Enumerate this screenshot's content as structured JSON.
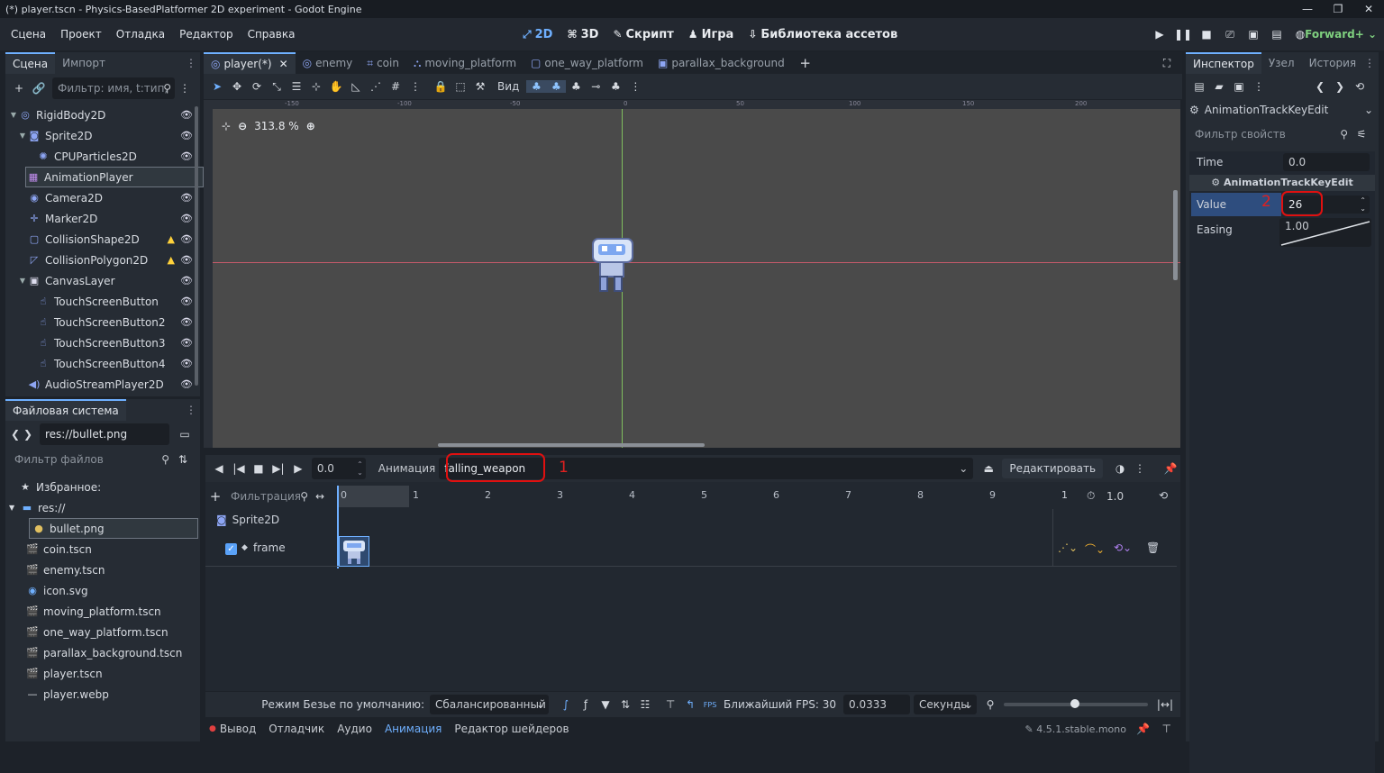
{
  "window": {
    "title": "(*) player.tscn - Physics-BasedPlatformer 2D experiment - Godot Engine"
  },
  "menu": [
    "Сцена",
    "Проект",
    "Отладка",
    "Редактор",
    "Справка"
  ],
  "workspaces": [
    {
      "icon": "⤢",
      "label": "2D"
    },
    {
      "icon": "⌘",
      "label": "3D"
    },
    {
      "icon": "✎",
      "label": "Скрипт"
    },
    {
      "icon": "♟",
      "label": "Игра"
    },
    {
      "icon": "⇩",
      "label": "Библиотека ассетов"
    }
  ],
  "renderer": "Forward+",
  "scene_dock": {
    "tabs": [
      "Сцена",
      "Импорт"
    ],
    "filter_placeholder": "Фильтр: имя, t:тип,",
    "nodes": [
      {
        "label": "RigidBody2D",
        "depth": 0,
        "arrow": "v",
        "icon": "◎",
        "color": "#8da5f3",
        "eye": true
      },
      {
        "label": "Sprite2D",
        "depth": 1,
        "arrow": "v",
        "icon": "◙",
        "color": "#8da5f3",
        "eye": true
      },
      {
        "label": "CPUParticles2D",
        "depth": 2,
        "arrow": "",
        "icon": "✺",
        "color": "#8da5f3",
        "eye": true
      },
      {
        "label": "AnimationPlayer",
        "depth": 1,
        "arrow": "",
        "icon": "▦",
        "color": "#c38ef1",
        "eye": false,
        "selected": true
      },
      {
        "label": "Camera2D",
        "depth": 1,
        "arrow": "",
        "icon": "◉",
        "color": "#8da5f3",
        "eye": true
      },
      {
        "label": "Marker2D",
        "depth": 1,
        "arrow": "",
        "icon": "✛",
        "color": "#8da5f3",
        "eye": true
      },
      {
        "label": "CollisionShape2D",
        "depth": 1,
        "arrow": "",
        "icon": "▢",
        "color": "#8da5f3",
        "eye": true,
        "warn": true
      },
      {
        "label": "CollisionPolygon2D",
        "depth": 1,
        "arrow": "",
        "icon": "◸",
        "color": "#8da5f3",
        "eye": true,
        "warn": true
      },
      {
        "label": "CanvasLayer",
        "depth": 1,
        "arrow": "v",
        "icon": "▣",
        "color": "#dde",
        "eye": true
      },
      {
        "label": "TouchScreenButton",
        "depth": 2,
        "arrow": "",
        "icon": "☝",
        "color": "#8da5f3",
        "eye": true
      },
      {
        "label": "TouchScreenButton2",
        "depth": 2,
        "arrow": "",
        "icon": "☝",
        "color": "#8da5f3",
        "eye": true
      },
      {
        "label": "TouchScreenButton3",
        "depth": 2,
        "arrow": "",
        "icon": "☝",
        "color": "#8da5f3",
        "eye": true
      },
      {
        "label": "TouchScreenButton4",
        "depth": 2,
        "arrow": "",
        "icon": "☝",
        "color": "#8da5f3",
        "eye": true
      },
      {
        "label": "AudioStreamPlayer2D",
        "depth": 1,
        "arrow": "",
        "icon": "◀)",
        "color": "#8da5f3",
        "eye": true
      }
    ]
  },
  "filesystem": {
    "tab": "Файловая система",
    "path": "res://bullet.png",
    "filter_placeholder": "Фильтр файлов",
    "items": [
      {
        "label": "Избранное:",
        "icon": "★",
        "indent": 0,
        "arrow": ""
      },
      {
        "label": "res://",
        "icon": "▬",
        "indent": 0,
        "arrow": "v",
        "color": "#6fb0ff"
      },
      {
        "label": "bullet.png",
        "icon": "●",
        "indent": 1,
        "selected": true,
        "color": "#e0c060"
      },
      {
        "label": "coin.tscn",
        "icon": "🎬",
        "indent": 1
      },
      {
        "label": "enemy.tscn",
        "icon": "🎬",
        "indent": 1
      },
      {
        "label": "icon.svg",
        "icon": "◉",
        "indent": 1,
        "color": "#6fb0ff"
      },
      {
        "label": "moving_platform.tscn",
        "icon": "🎬",
        "indent": 1
      },
      {
        "label": "one_way_platform.tscn",
        "icon": "🎬",
        "indent": 1
      },
      {
        "label": "parallax_background.tscn",
        "icon": "🎬",
        "indent": 1
      },
      {
        "label": "player.tscn",
        "icon": "🎬",
        "indent": 1
      },
      {
        "label": "player.webp",
        "icon": "—",
        "indent": 1
      }
    ]
  },
  "scene_tabs": [
    {
      "label": "player(*)",
      "icon": "◎",
      "active": true,
      "close": "✕"
    },
    {
      "label": "enemy",
      "icon": "◎"
    },
    {
      "label": "coin",
      "icon": "⌗"
    },
    {
      "label": "moving_platform",
      "icon": "⛬"
    },
    {
      "label": "one_way_platform",
      "icon": "▢"
    },
    {
      "label": "parallax_background",
      "icon": "▣"
    }
  ],
  "toolbar": {
    "view_label": "Вид"
  },
  "viewport": {
    "zoom": "313.8 %",
    "ruler_labels": [
      "-150",
      "-100",
      "-50",
      "0",
      "50",
      "100",
      "150",
      "200"
    ]
  },
  "animation": {
    "time": "0.0",
    "anim_label": "Анимация",
    "anim_name": "falling_weapon",
    "edit_label": "Редактировать",
    "filter_placeholder": "Фильтрация",
    "length": "1.0",
    "marker_end": "1",
    "ticks": [
      "0",
      "1",
      "2",
      "3",
      "4",
      "5",
      "6",
      "7",
      "8",
      "9"
    ],
    "track_node": "Sprite2D",
    "track_prop": "frame",
    "bezier_label": "Режим Безье по умолчанию:",
    "bezier_value": "Сбалансированный",
    "fps_label": "Ближайший FPS: 30",
    "step": "0.0333",
    "unit": "Секунды",
    "annot1": "1"
  },
  "inspector": {
    "tabs": [
      "Инспектор",
      "Узел",
      "История"
    ],
    "object": "AnimationTrackKeyEdit",
    "filter_placeholder": "Фильтр свойств",
    "section": "AnimationTrackKeyEdit",
    "props": {
      "time_label": "Time",
      "time_value": "0.0",
      "value_label": "Value",
      "value_value": "26",
      "easing_label": "Easing",
      "easing_value": "1.00"
    },
    "annot2": "2"
  },
  "bottom": {
    "tabs": [
      "Вывод",
      "Отладчик",
      "Аудио",
      "Анимация",
      "Редактор шейдеров"
    ],
    "version": "4.5.1.stable.mono"
  },
  "colors": {
    "accent": "#6fb0ff",
    "annot": "#e01010"
  }
}
